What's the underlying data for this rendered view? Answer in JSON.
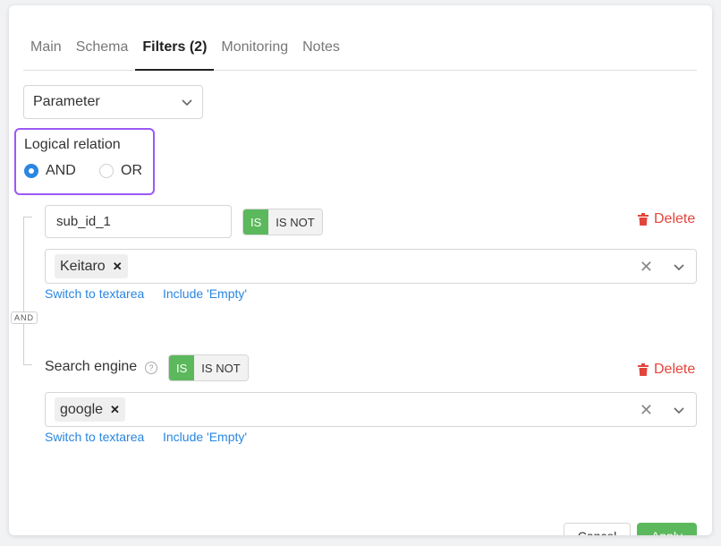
{
  "tabs": [
    {
      "label": "Main"
    },
    {
      "label": "Schema"
    },
    {
      "label": "Filters (2)"
    },
    {
      "label": "Monitoring"
    },
    {
      "label": "Notes"
    }
  ],
  "param_select": {
    "value": "Parameter"
  },
  "logical": {
    "title": "Logical relation",
    "and_label": "AND",
    "or_label": "OR",
    "selected": "AND"
  },
  "and_badge": "AND",
  "filter1": {
    "field_value": "sub_id_1",
    "is_label": "IS",
    "is_not_label": "IS NOT",
    "delete_label": "Delete",
    "tag": "Keitaro",
    "switch_link": "Switch to textarea",
    "empty_link": "Include 'Empty'"
  },
  "filter2": {
    "label": "Search engine",
    "help": "?",
    "is_label": "IS",
    "is_not_label": "IS NOT",
    "delete_label": "Delete",
    "tag": "google",
    "switch_link": "Switch to textarea",
    "empty_link": "Include 'Empty'"
  },
  "footer": {
    "cancel": "Cancel",
    "apply": "Apply"
  },
  "colors": {
    "accent": "#2a86e0",
    "success": "#5cb85c",
    "danger": "#e2453c",
    "highlight": "#9b59f6"
  }
}
